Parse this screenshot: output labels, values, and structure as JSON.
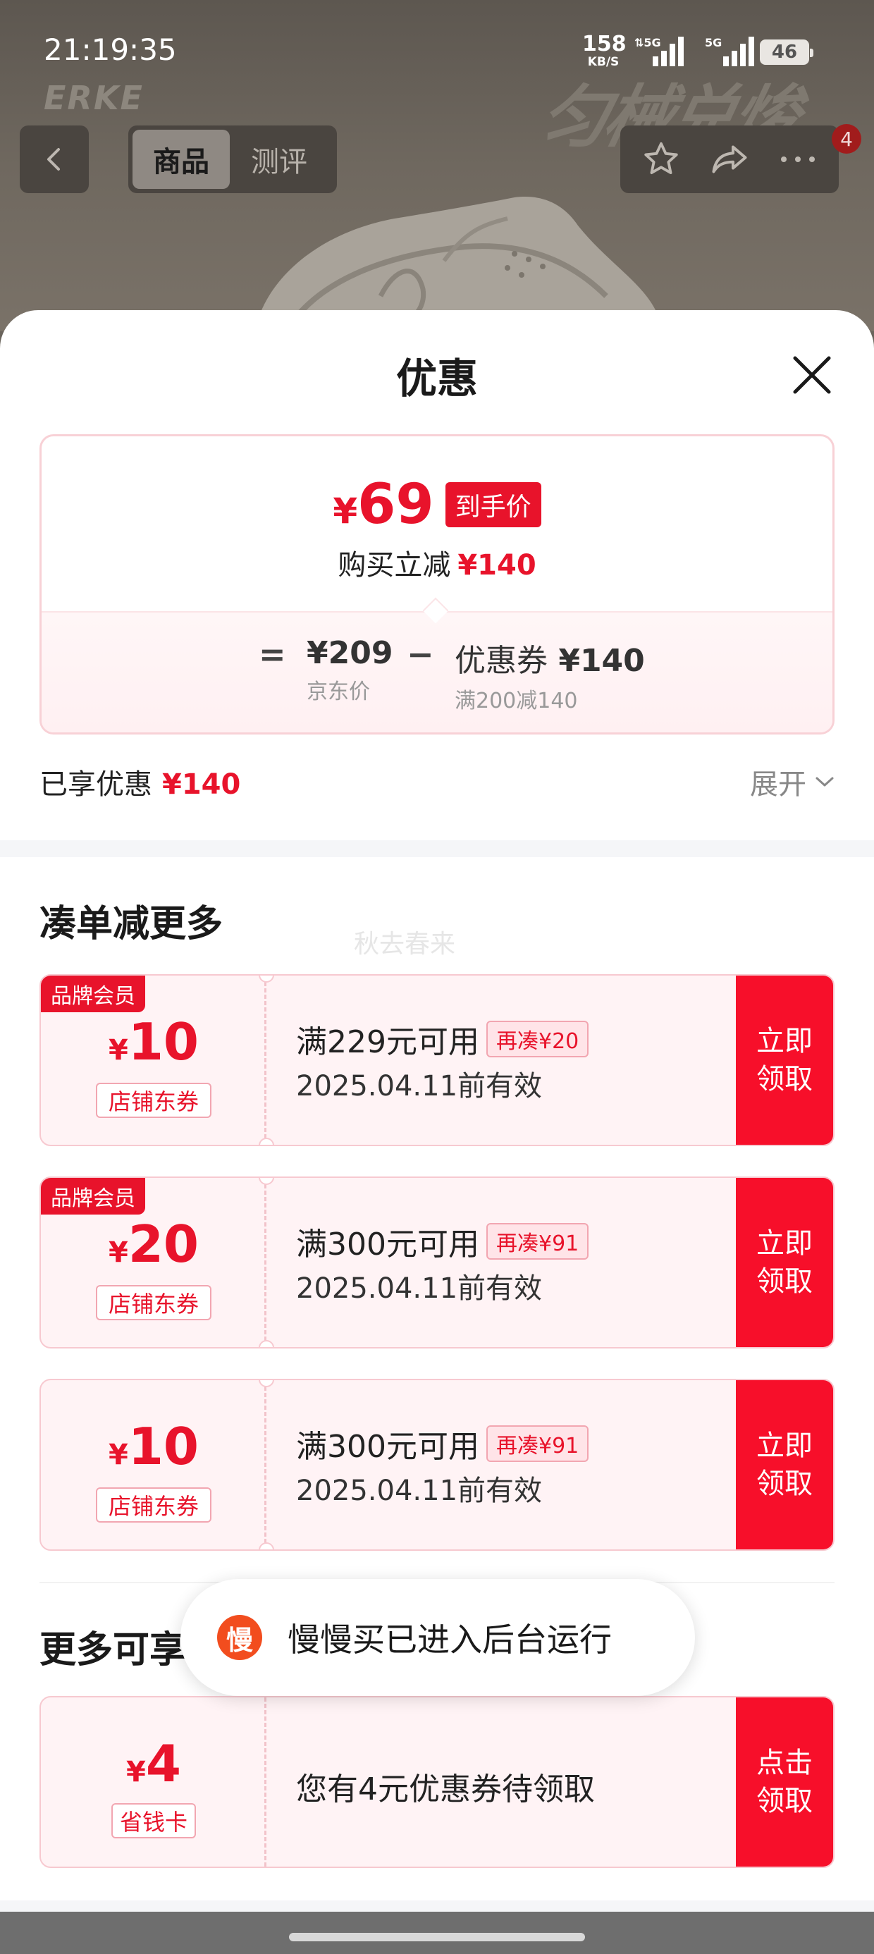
{
  "status_bar": {
    "time": "21:19:35",
    "net_speed_value": "158",
    "net_speed_unit": "KB/S",
    "signal1_label": "5G",
    "signal2_label": "5G",
    "battery": "46"
  },
  "background": {
    "brand_watermark": "ERKE",
    "slogan_watermark": "匀械兑焌"
  },
  "top_nav": {
    "tabs": [
      {
        "label": "商品",
        "active": true
      },
      {
        "label": "测评",
        "active": false
      }
    ],
    "notification_badge": "4"
  },
  "sheet": {
    "title": "优惠",
    "price_card": {
      "currency": "¥",
      "final_price": "69",
      "final_price_tag": "到手价",
      "instant_save_label": "购买立减",
      "instant_save_amount": "¥140",
      "eq_sign": "=",
      "minus_sign": "−",
      "jd_price": "¥209",
      "jd_price_label": "京东价",
      "coupon_label": "优惠券",
      "coupon_amount": "¥140",
      "coupon_rule": "满200减140"
    },
    "enjoyed_label": "已享优惠",
    "enjoyed_amount": "¥140",
    "expand_label": "展开",
    "combine_section_title": "凑单减更多",
    "user_watermark": "秋去春来",
    "coupons": [
      {
        "member_tag": "品牌会员",
        "currency": "¥",
        "amount": "10",
        "kind": "店铺东券",
        "condition": "满229元可用",
        "add_more": "再凑¥20",
        "validity": "2025.04.11前有效",
        "cta": "立即\n领取"
      },
      {
        "member_tag": "品牌会员",
        "currency": "¥",
        "amount": "20",
        "kind": "店铺东券",
        "condition": "满300元可用",
        "add_more": "再凑¥91",
        "validity": "2025.04.11前有效",
        "cta": "立即\n领取"
      },
      {
        "member_tag": "",
        "currency": "¥",
        "amount": "10",
        "kind": "店铺东券",
        "condition": "满300元可用",
        "add_more": "再凑¥91",
        "validity": "2025.04.11前有效",
        "cta": "立即\n领取"
      }
    ],
    "more_section_title": "更多可享",
    "saver_card": {
      "currency": "¥",
      "amount": "4",
      "kind": "省钱卡",
      "text": "您有4元优惠券待领取",
      "cta": "点击\n领取"
    }
  },
  "toast": {
    "app_icon_char": "慢",
    "message": "慢慢买已进入后台运行"
  },
  "colors": {
    "accent_red": "#e8132b",
    "cta_red": "#f70f2a",
    "toast_icon": "#f24d1e"
  }
}
